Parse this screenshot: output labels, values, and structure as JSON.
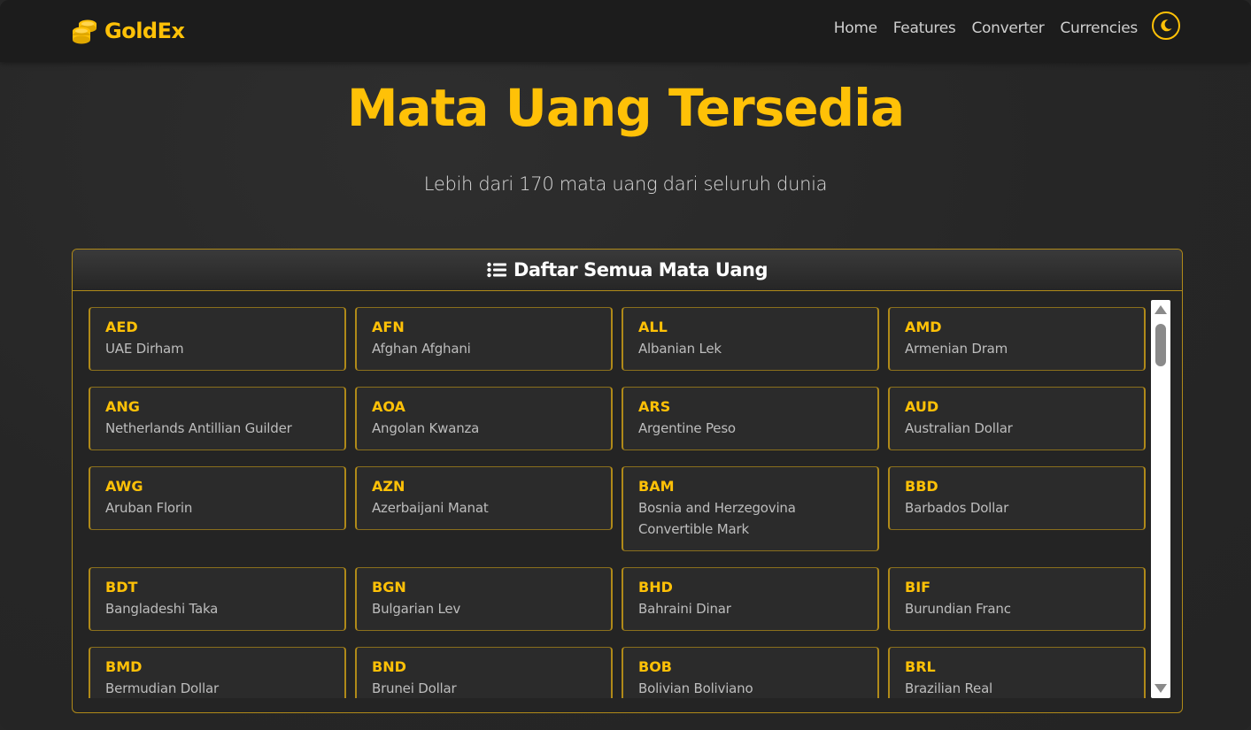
{
  "colors": {
    "accent": "#ffc107",
    "background": "#262626",
    "navbar": "#1c1c1c",
    "border": "#b08a19"
  },
  "navbar": {
    "brand": "GoldEx",
    "brand_icon": "coins-icon",
    "links": [
      "Home",
      "Features",
      "Converter",
      "Currencies"
    ],
    "theme_toggle_icon": "moon-icon"
  },
  "hero": {
    "title": "Mata Uang Tersedia",
    "subtitle": "Lebih dari 170 mata uang dari seluruh dunia"
  },
  "panel": {
    "icon": "list-icon",
    "title": "Daftar Semua Mata Uang",
    "currencies": [
      {
        "code": "AED",
        "name": "UAE Dirham"
      },
      {
        "code": "AFN",
        "name": "Afghan Afghani"
      },
      {
        "code": "ALL",
        "name": "Albanian Lek"
      },
      {
        "code": "AMD",
        "name": "Armenian Dram"
      },
      {
        "code": "ANG",
        "name": "Netherlands Antillian Guilder"
      },
      {
        "code": "AOA",
        "name": "Angolan Kwanza"
      },
      {
        "code": "ARS",
        "name": "Argentine Peso"
      },
      {
        "code": "AUD",
        "name": "Australian Dollar"
      },
      {
        "code": "AWG",
        "name": "Aruban Florin"
      },
      {
        "code": "AZN",
        "name": "Azerbaijani Manat"
      },
      {
        "code": "BAM",
        "name": "Bosnia and Herzegovina Convertible Mark"
      },
      {
        "code": "BBD",
        "name": "Barbados Dollar"
      },
      {
        "code": "BDT",
        "name": "Bangladeshi Taka"
      },
      {
        "code": "BGN",
        "name": "Bulgarian Lev"
      },
      {
        "code": "BHD",
        "name": "Bahraini Dinar"
      },
      {
        "code": "BIF",
        "name": "Burundian Franc"
      },
      {
        "code": "BMD",
        "name": "Bermudian Dollar"
      },
      {
        "code": "BND",
        "name": "Brunei Dollar"
      },
      {
        "code": "BOB",
        "name": "Bolivian Boliviano"
      },
      {
        "code": "BRL",
        "name": "Brazilian Real"
      }
    ]
  }
}
